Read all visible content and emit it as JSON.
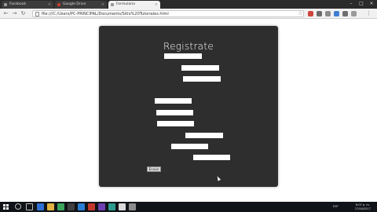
{
  "browser": {
    "tabs": [
      {
        "title": "Facebook",
        "active": false
      },
      {
        "title": "Google Drive",
        "active": false
      },
      {
        "title": "Formulario",
        "active": true
      }
    ],
    "url": "file:///C:/Users/PC-PRINCIPAL/Documents/Sitio%20Tutoriales.html",
    "colors": {
      "tabstrip": "#2b2b2b",
      "toolbar": "#f1f1f1"
    }
  },
  "page": {
    "heading": "Registrate",
    "submit_label": "Enviar",
    "colors": {
      "background": "#ffffff",
      "card": "#2e2e2e",
      "field": "#ffffff",
      "heading": "#ffffff"
    }
  },
  "taskbar": {
    "tray_language": "ESP",
    "clock_time": "8:07 p. m.",
    "clock_date": "17/04/2017",
    "colors": {
      "background": "#101318"
    }
  }
}
